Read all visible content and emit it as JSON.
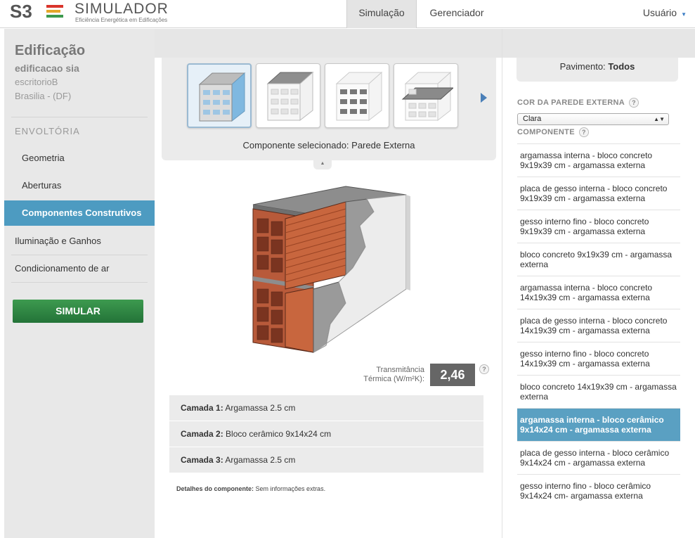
{
  "header": {
    "brand_name": "SIMULADOR",
    "brand_tagline": "Eficiência Energética em Edificações",
    "nav": {
      "simulacao": "Simulação",
      "gerenciador": "Gerenciador",
      "usuario": "Usuário"
    }
  },
  "sidebar": {
    "building_title": "Edificação",
    "building_name": "edificacao sia",
    "building_type": "escritorioB",
    "location": "Brasilia - (DF)",
    "section_heading": "ENVOLTÓRIA",
    "items": [
      {
        "label": "Geometria"
      },
      {
        "label": "Aberturas"
      },
      {
        "label": "Componentes Construtivos"
      },
      {
        "label": "Iluminação e Ganhos"
      },
      {
        "label": "Condicionamento de ar"
      }
    ],
    "simulate_label": "SIMULAR"
  },
  "main": {
    "selected_component": "Componente selecionado: Parede Externa",
    "transmittance_label_line1": "Transmitância",
    "transmittance_label_line2": "Térmica (W/m²K):",
    "transmittance_value": "2,46",
    "help": "?",
    "layers": [
      {
        "name": "Camada 1:",
        "value": "Argamassa 2.5 cm"
      },
      {
        "name": "Camada 2:",
        "value": "Bloco cerâmico 9x14x24 cm"
      },
      {
        "name": "Camada 3:",
        "value": "Argamassa 2.5 cm"
      }
    ],
    "details_label": "Detalhes do componente:",
    "details_value": "Sem informações extras."
  },
  "right": {
    "pavimento_label": "Pavimento:",
    "pavimento_value": "Todos",
    "wall_color_label": "COR DA PAREDE EXTERNA",
    "wall_color_value": "Clara",
    "component_label": "COMPONENTE",
    "components": [
      "argamassa interna - bloco concreto 9x19x39 cm - argamassa externa",
      "placa de gesso interna - bloco concreto 9x19x39 cm - argamassa externa",
      "gesso interno fino - bloco concreto 9x19x39 cm - argamassa externa",
      "bloco concreto 9x19x39 cm - argamassa externa",
      "argamassa interna - bloco concreto 14x19x39 cm - argamassa externa",
      "placa de gesso interna - bloco concreto 14x19x39 cm - argamassa externa",
      "gesso interno fino - bloco concreto 14x19x39 cm - argamassa externa",
      "bloco concreto 14x19x39 cm - argamassa externa",
      "argamassa interna - bloco cerâmico 9x14x24 cm - argamassa externa",
      "placa de gesso interna - bloco cerâmico 9x14x24 cm - argamassa externa",
      "gesso interno fino - bloco cerâmico 9x14x24 cm- argamassa externa"
    ],
    "active_index": 8
  },
  "colors": {
    "accent": "#4d9bc1",
    "simulate_button": "#2f8a44",
    "active_component": "#5aa0c2"
  },
  "icons": [
    "s3e-logo",
    "help-icon",
    "chevron-right-icon",
    "chevron-up-icon",
    "caret-down-icon"
  ]
}
